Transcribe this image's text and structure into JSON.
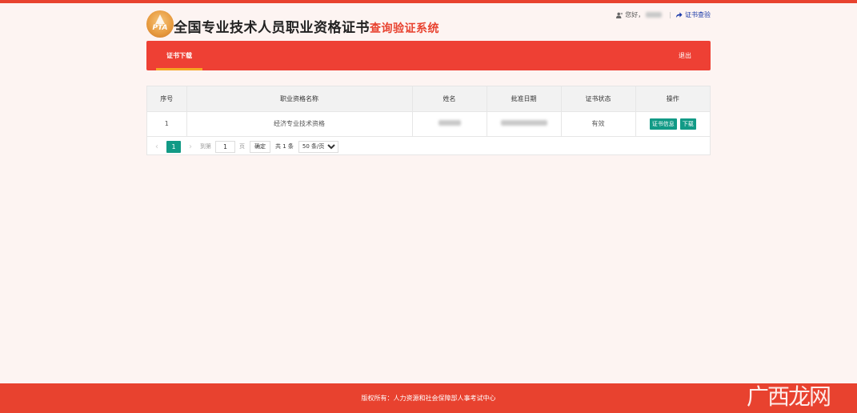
{
  "header": {
    "logo_text": "PTA",
    "title_main": "全国专业技术人员职业资格证书",
    "title_sub": "查询验证系统",
    "greeting": "您好，",
    "separator": "|",
    "verify_link": "证书查验"
  },
  "nav": {
    "tab_download": "证书下载",
    "logout": "退出"
  },
  "table": {
    "columns": [
      "序号",
      "职业资格名称",
      "姓名",
      "批准日期",
      "证书状态",
      "操作"
    ],
    "rows": [
      {
        "index": "1",
        "qualification": "经济专业技术资格",
        "status": "有效",
        "btn_info": "证书信息",
        "btn_download": "下载"
      }
    ]
  },
  "pagination": {
    "prev": "‹",
    "current_page": "1",
    "next": "›",
    "goto_prefix": "到第",
    "goto_value": "1",
    "goto_suffix": "页",
    "confirm": "确定",
    "total": "共 1 条",
    "page_size": "50 条/页"
  },
  "footer": {
    "copyright": "版权所有：人力资源和社会保障部人事考试中心",
    "watermark": "广西龙网"
  },
  "colors": {
    "brand_red": "#ee4034",
    "accent_teal": "#129a86",
    "tab_underline": "#f5a623"
  }
}
